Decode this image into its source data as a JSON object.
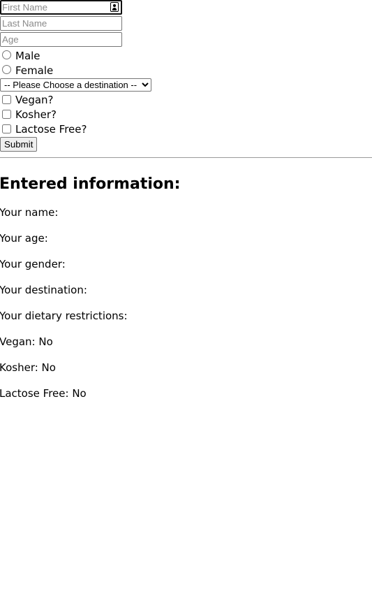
{
  "form": {
    "first_name": {
      "placeholder": "First Name",
      "value": ""
    },
    "last_name": {
      "placeholder": "Last Name",
      "value": ""
    },
    "age": {
      "placeholder": "Age",
      "value": ""
    },
    "gender_options": [
      {
        "label": "Male"
      },
      {
        "label": "Female"
      }
    ],
    "destination_select": {
      "selected": "-- Please Choose a destination --"
    },
    "dietary_options": [
      {
        "label": "Vegan?"
      },
      {
        "label": "Kosher?"
      },
      {
        "label": "Lactose Free?"
      }
    ],
    "submit_label": "Submit"
  },
  "results": {
    "title": "Entered information:",
    "name_line": "Your name:",
    "age_line": "Your age:",
    "gender_line": "Your gender:",
    "destination_line": "Your destination:",
    "dietary_line": "Your dietary restrictions:",
    "vegan_line": "Vegan: No",
    "kosher_line": "Kosher: No",
    "lactose_line": "Lactose Free: No"
  }
}
